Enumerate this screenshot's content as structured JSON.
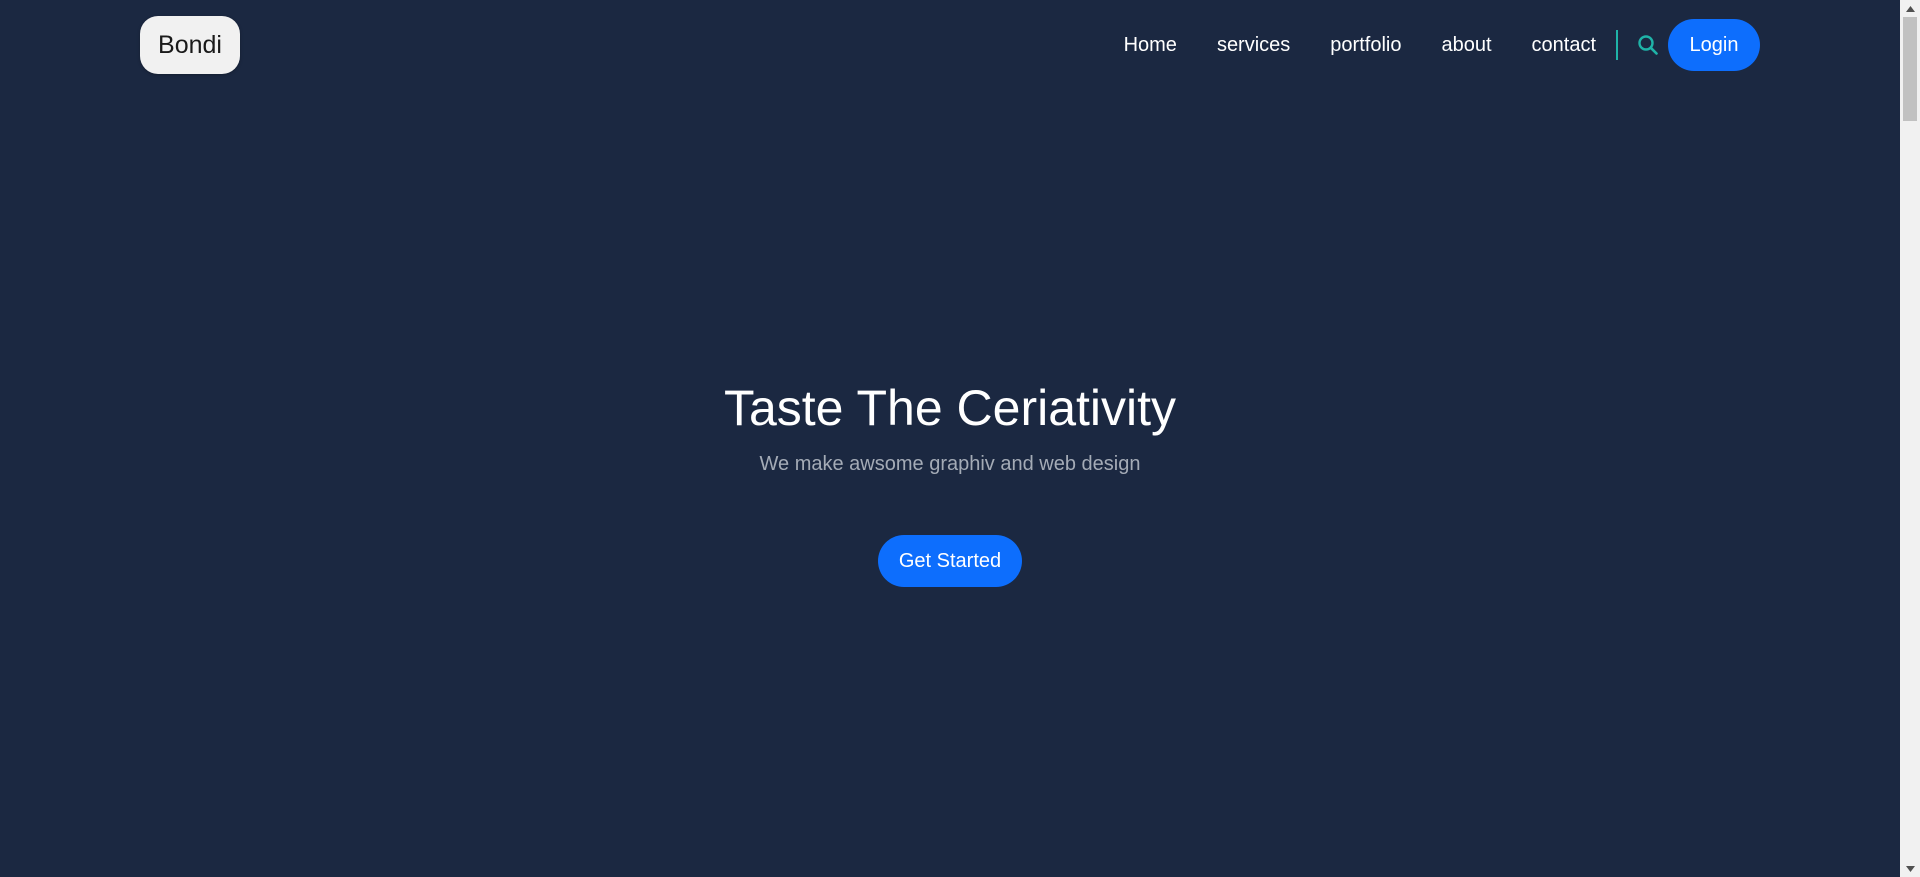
{
  "header": {
    "logo_text": "Bondi",
    "nav": [
      {
        "label": "Home"
      },
      {
        "label": "services"
      },
      {
        "label": "portfolio"
      },
      {
        "label": "about"
      },
      {
        "label": "contact"
      }
    ],
    "search_icon": "search-icon",
    "login_label": "Login"
  },
  "hero": {
    "title": "Taste The Ceriativity",
    "subtitle": "We make awsome graphiv and web design",
    "cta_label": "Get Started"
  },
  "colors": {
    "background": "#1b2841",
    "accent": "#0d6efd",
    "divider": "#1fb3a8",
    "search_icon": "#1fb3a8"
  }
}
